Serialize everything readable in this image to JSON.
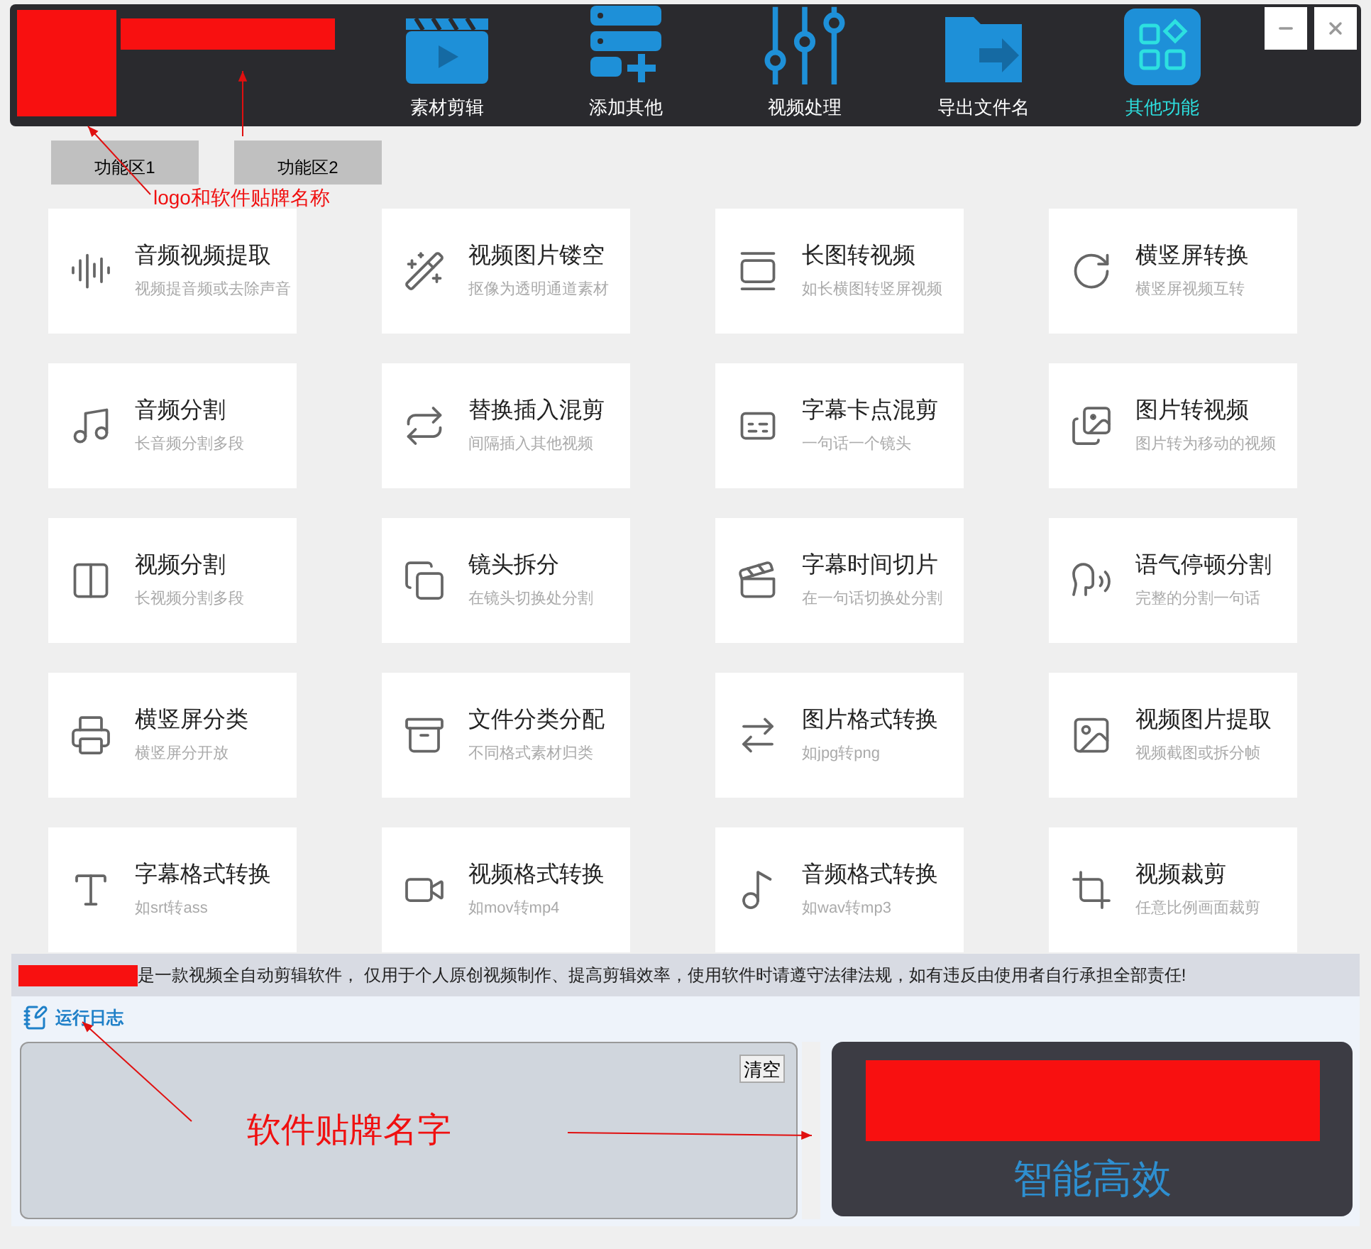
{
  "nav": [
    {
      "label": "素材剪辑",
      "selected": false
    },
    {
      "label": "添加其他",
      "selected": false
    },
    {
      "label": "视频处理",
      "selected": false
    },
    {
      "label": "导出文件名",
      "selected": false
    },
    {
      "label": "其他功能",
      "selected": true
    }
  ],
  "tabs": [
    {
      "label": "功能区1"
    },
    {
      "label": "功能区2"
    }
  ],
  "tools": [
    {
      "title": "音频视频提取",
      "subtitle": "视频提音频或去除声音"
    },
    {
      "title": "视频图片镂空",
      "subtitle": "抠像为透明通道素材"
    },
    {
      "title": "长图转视频",
      "subtitle": "如长横图转竖屏视频"
    },
    {
      "title": "横竖屏转换",
      "subtitle": "横竖屏视频互转"
    },
    {
      "title": "音频分割",
      "subtitle": "长音频分割多段"
    },
    {
      "title": "替换插入混剪",
      "subtitle": "间隔插入其他视频"
    },
    {
      "title": "字幕卡点混剪",
      "subtitle": "一句话一个镜头"
    },
    {
      "title": "图片转视频",
      "subtitle": "图片转为移动的视频"
    },
    {
      "title": "视频分割",
      "subtitle": "长视频分割多段"
    },
    {
      "title": "镜头拆分",
      "subtitle": "在镜头切换处分割"
    },
    {
      "title": "字幕时间切片",
      "subtitle": "在一句话切换处分割"
    },
    {
      "title": "语气停顿分割",
      "subtitle": "完整的分割一句话"
    },
    {
      "title": "横竖屏分类",
      "subtitle": "横竖屏分开放"
    },
    {
      "title": "文件分类分配",
      "subtitle": "不同格式素材归类"
    },
    {
      "title": "图片格式转换",
      "subtitle": "如jpg转png"
    },
    {
      "title": "视频图片提取",
      "subtitle": "视频截图或拆分帧"
    },
    {
      "title": "字幕格式转换",
      "subtitle": "如srt转ass"
    },
    {
      "title": "视频格式转换",
      "subtitle": "如mov转mp4"
    },
    {
      "title": "音频格式转换",
      "subtitle": "如wav转mp3"
    },
    {
      "title": "视频裁剪",
      "subtitle": "任意比例画面裁剪"
    }
  ],
  "notice": "是一款视频全自动剪辑软件， 仅用于个人原创视频制作、提高剪辑效率，使用软件时请遵守法律法规，如有违反由使用者自行承担全部责任!",
  "log": {
    "label": "运行日志",
    "clear_button": "清空"
  },
  "slogan": "智能高效",
  "annotations": [
    {
      "text": "logo和软件贴牌名称"
    },
    {
      "text": "软件贴牌名字"
    }
  ]
}
